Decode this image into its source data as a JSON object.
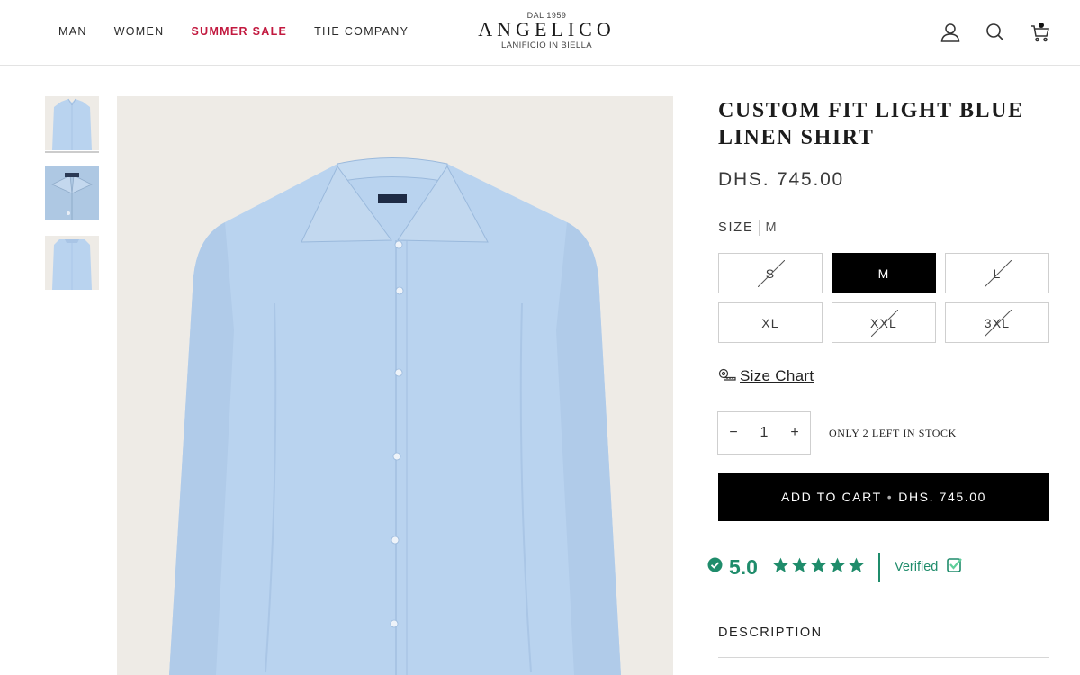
{
  "header": {
    "nav": [
      {
        "label": "MAN"
      },
      {
        "label": "WOMEN"
      },
      {
        "label": "SUMMER SALE"
      },
      {
        "label": "THE COMPANY"
      }
    ],
    "logo": {
      "est": "DAL 1959",
      "name": "ANGELICO",
      "tagline": "LANIFICIO IN BIELLA"
    },
    "icons": [
      "account-icon",
      "search-icon",
      "cart-icon"
    ]
  },
  "gallery": {
    "thumbnails": [
      "shirt-front-thumbnail",
      "shirt-collar-thumbnail",
      "shirt-back-thumbnail"
    ],
    "selected_index": 0,
    "shirt_color": "#b9d3ef"
  },
  "product": {
    "title": "CUSTOM FIT LIGHT BLUE LINEN SHIRT",
    "price": "DHS. 745.00",
    "size_label": "SIZE",
    "selected_size": "M",
    "sizes": [
      {
        "label": "S",
        "available": false
      },
      {
        "label": "M",
        "available": true,
        "selected": true
      },
      {
        "label": "L",
        "available": false
      },
      {
        "label": "XL",
        "available": true
      },
      {
        "label": "XXL",
        "available": false
      },
      {
        "label": "3XL",
        "available": false
      }
    ],
    "size_chart_label": "Size Chart",
    "quantity": "1",
    "qty_minus": "−",
    "qty_plus": "+",
    "stock_note": "ONLY 2 LEFT IN STOCK",
    "cart": {
      "label": "ADD TO CART",
      "separator": "•",
      "price": "DHS. 745.00"
    },
    "rating": {
      "score": "5.0",
      "stars": 5,
      "verified_label": "Verified",
      "color": "#1f8c6b"
    },
    "description_label": "DESCRIPTION"
  }
}
